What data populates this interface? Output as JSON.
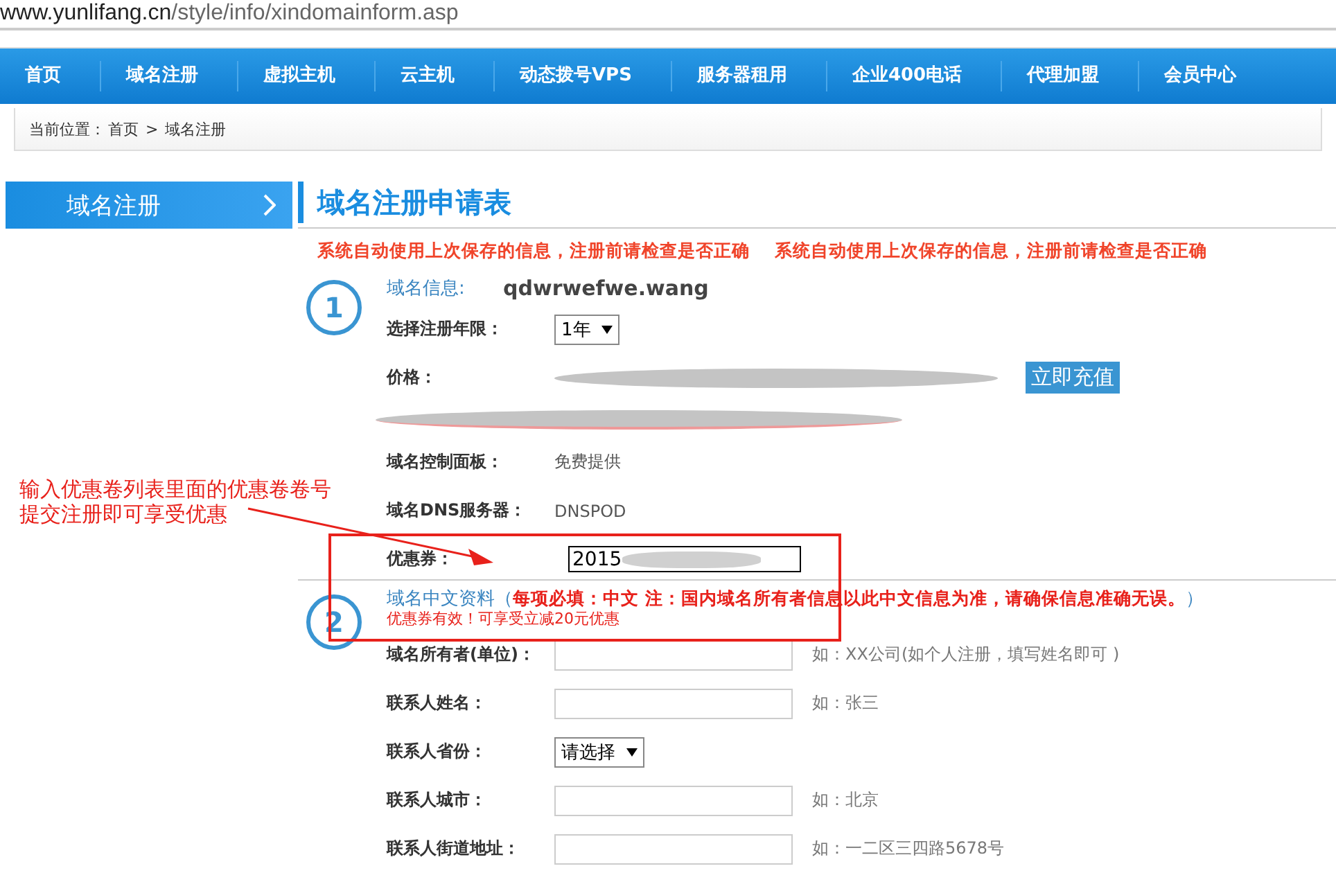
{
  "address_bar": {
    "host": "www.yunlifang.cn",
    "path": "/style/info/xindomainform.asp"
  },
  "nav": [
    {
      "label": "首页"
    },
    {
      "label": "域名注册"
    },
    {
      "label": "虚拟主机"
    },
    {
      "label": "云主机"
    },
    {
      "label": "动态拨号VPS"
    },
    {
      "label": "服务器租用"
    },
    {
      "label": "企业400电话"
    },
    {
      "label": "代理加盟"
    },
    {
      "label": "会员中心"
    }
  ],
  "breadcrumb": {
    "prefix": "当前位置：",
    "home": "首页",
    "separator": ">",
    "current": "域名注册"
  },
  "sidebar": {
    "items": [
      {
        "label": "域名注册",
        "selected": true
      }
    ]
  },
  "form": {
    "title": "域名注册申请表",
    "notices": [
      "系统自动使用上次保存的信息，注册前请检查是否正确",
      "系统自动使用上次保存的信息，注册前请检查是否正确"
    ],
    "step1": {
      "number": "1",
      "domain_label": "域名信息:",
      "domain": "qdwrwefwe.wang",
      "period_label": "选择注册年限：",
      "period": "1年",
      "price_label": "价格：",
      "recharge_button": "立即充值",
      "panel_label": "域名控制面板：",
      "panel_value": "免费提供",
      "dns_label": "域名DNS服务器：",
      "dns_value": "DNSPOD",
      "coupon_label": "优惠券：",
      "coupon_value": "2015"
    },
    "step2": {
      "number": "2",
      "title": "域名中文资料（",
      "required": "每项必填：中文 注：国内域名所有者信息以此中文信息为准，请确保信息准确无误。",
      "title_end": "）",
      "coupon_valid": "优惠券有效！可享受立减20元优惠",
      "fields": [
        {
          "kind": "input",
          "label": "域名所有者(单位)：",
          "hint": "如：XX公司(如个人注册，填写姓名即可 )"
        },
        {
          "kind": "input",
          "label": "联系人姓名：",
          "hint": "如：张三"
        },
        {
          "kind": "select",
          "label": "联系人省份：",
          "value": "请选择"
        },
        {
          "kind": "input",
          "label": "联系人城市：",
          "hint": "如：北京"
        },
        {
          "kind": "input",
          "label": "联系人街道地址：",
          "hint": "如：一二区三四路5678号"
        }
      ]
    }
  },
  "annotation": {
    "lines": [
      "输入优惠卷列表里面的优惠卷卷号",
      "提交注册即可享受优惠"
    ]
  }
}
